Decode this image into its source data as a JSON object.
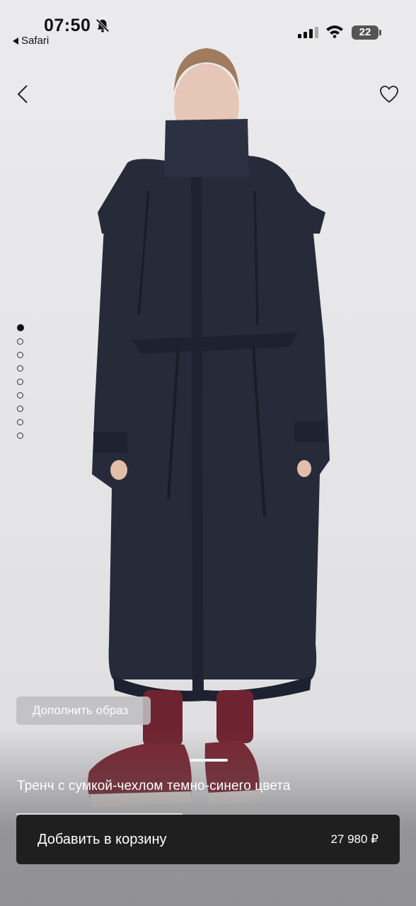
{
  "status_bar": {
    "time": "07:50",
    "back_app": "Safari",
    "battery": "22"
  },
  "icons": {
    "back": "chevron-left-icon",
    "favorite": "heart-icon",
    "silent": "bell-slash-icon",
    "signal": "cellular-signal-icon",
    "wifi": "wifi-icon"
  },
  "gallery": {
    "image_count": 9,
    "active_index": 0
  },
  "complete_look_label": "Дополнить образ",
  "product": {
    "title": "Тренч с сумкой-чехлом темно-синего цвета",
    "price": "27 980 ₽"
  },
  "cart": {
    "add_label": "Добавить в корзину"
  },
  "colors": {
    "coat": "#262a39",
    "pants": "#6e2430",
    "shoes": "#7a2632",
    "button_bg": "#1f1f1f"
  }
}
